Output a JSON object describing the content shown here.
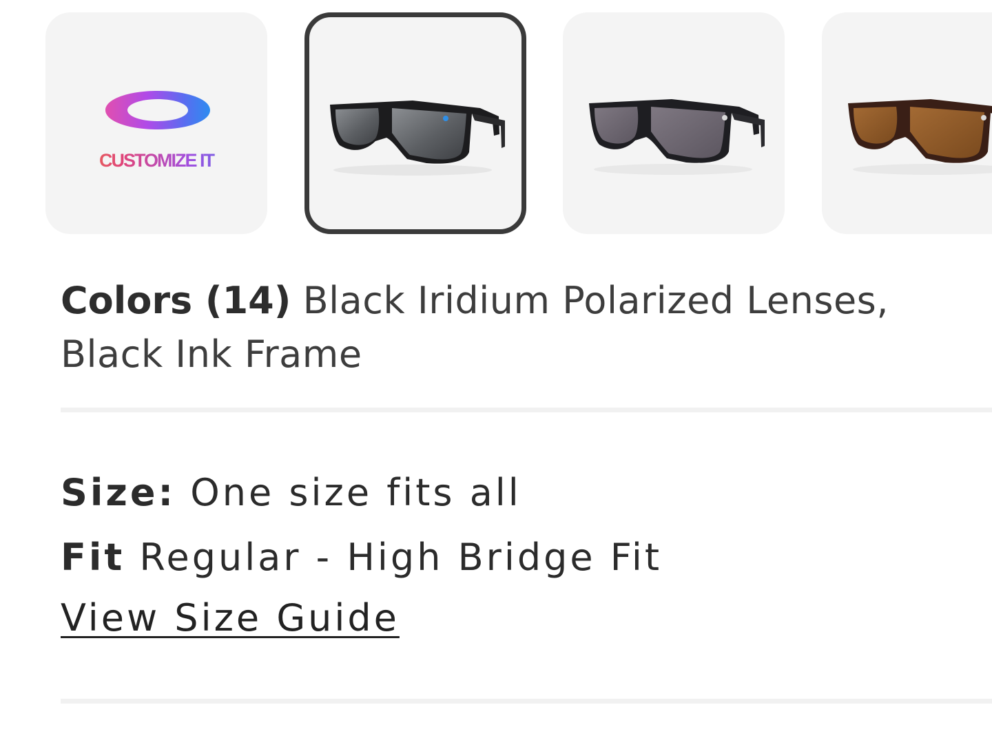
{
  "swatches": {
    "customize_label": "CUSTOMIZE IT",
    "items": [
      {
        "name": "black-iridium-black-ink",
        "lens_color": "#5c5f63",
        "frame_color": "#1c1c1e",
        "selected": true
      },
      {
        "name": "prizm-grey-black",
        "lens_color": "#6d6670",
        "frame_color": "#1e1e22",
        "selected": false
      },
      {
        "name": "prizm-bronze-tortoise",
        "lens_color": "#8a5626",
        "frame_color": "#3a1f16",
        "selected": false
      }
    ]
  },
  "colors": {
    "label": "Colors (14)",
    "value": "Black Iridium Polarized Lenses, Black Ink Frame"
  },
  "size": {
    "label": "Size:",
    "value": "One size fits all"
  },
  "fit": {
    "label": "Fit",
    "value": "Regular - High Bridge Fit"
  },
  "size_guide": {
    "label": "View Size Guide"
  },
  "theme": {
    "swatch_bg": "#f4f4f4",
    "selected_border": "#3a3a3a",
    "text": "#2b2b2b"
  }
}
